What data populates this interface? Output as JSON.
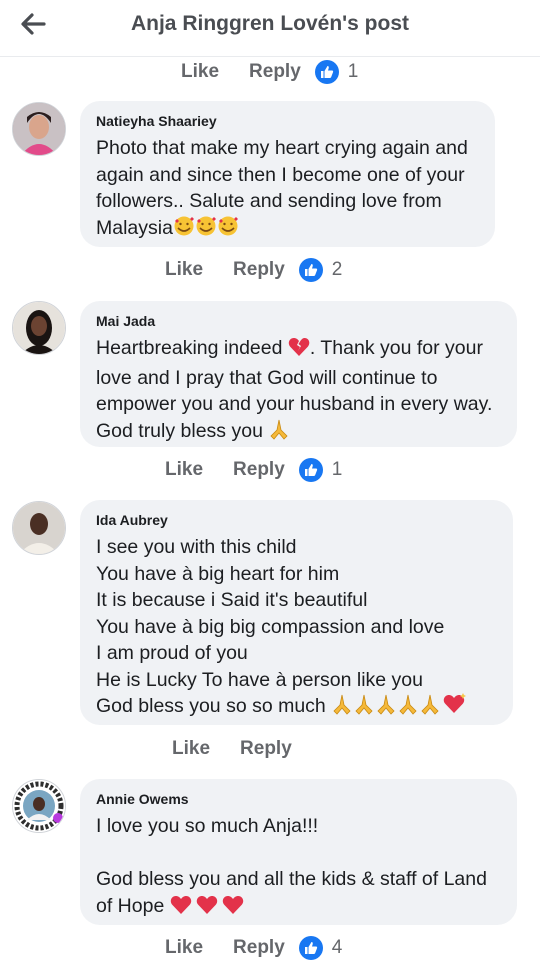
{
  "header": {
    "title": "Anja Ringgren Lovén's post"
  },
  "top_actions": {
    "like": "Like",
    "reply": "Reply",
    "reactions": "1"
  },
  "comments": [
    {
      "author": "Natieyha Shaariey",
      "lines": [
        "Photo that make my heart crying again and",
        "again and since then I become one of your",
        "followers.. Salute and sending love from",
        "Malaysia"
      ],
      "trailing_emojis": "smiling-face-with-hearts x3",
      "like": "Like",
      "reply": "Reply",
      "reactions": "2"
    },
    {
      "author": "Mai Jada",
      "lines": [
        "Heartbreaking indeed",
        ". Thank you for your",
        "love and I pray that God will continue to",
        "empower you and your husband in every way.",
        "God truly bless you"
      ],
      "like": "Like",
      "reply": "Reply",
      "reactions": "1"
    },
    {
      "author": "Ida Aubrey",
      "lines": [
        "I see you with this child",
        "You have à big heart for him",
        "It is because i Said it's beautiful",
        "You have à big big compassion and love",
        "I am proud of you",
        "He is Lucky To have à person like you",
        "God bless you so so much"
      ],
      "like": "Like",
      "reply": "Reply"
    },
    {
      "author": "Annie Owems",
      "lines": [
        "I love you so much Anja!!!",
        "",
        "God bless you and all the kids & staff of Land",
        "of Hope"
      ],
      "like": "Like",
      "reply": "Reply",
      "reactions": "4"
    }
  ],
  "colors": {
    "like_blue": "#1877f2",
    "bubble": "#f0f2f5",
    "action_gray": "#65676b"
  }
}
